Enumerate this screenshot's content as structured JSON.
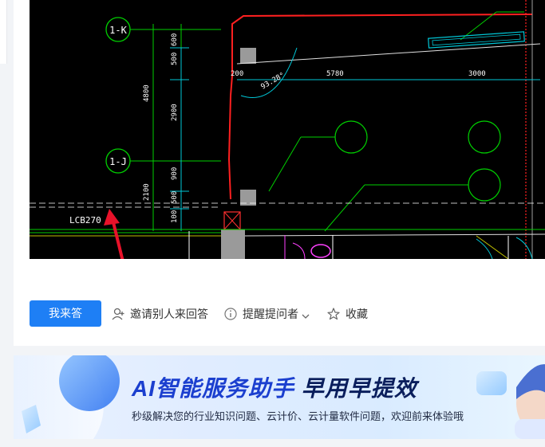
{
  "cad": {
    "grid_labels": [
      "1-K",
      "1-J"
    ],
    "dim_labels_top": [
      "200",
      "5780",
      "3000"
    ],
    "dim_labels_vertical": [
      "600",
      "500",
      "4800",
      "2900",
      "900",
      "500",
      "2100",
      "100"
    ],
    "angle_label": "93.28°",
    "beam_label": "LCB270"
  },
  "actions": {
    "answer_label": "我来答",
    "invite_label": "邀请别人来回答",
    "remind_label": "提醒提问者",
    "favorite_label": "收藏"
  },
  "banner": {
    "title_part1": "AI智能服务助手 ",
    "title_part2": "早用早提效",
    "subtitle": "秒级解决您的行业知识问题、云计价、云计量软件问题，欢迎前来体验哦"
  },
  "icons": {
    "invite": "user-plus-icon",
    "remind": "info-circle-icon",
    "remind_dropdown": "chevron-down-icon",
    "favorite": "star-icon",
    "banner_left": "glass-orb-icon",
    "banner_right": "robot-assistant-icon"
  },
  "colors": {
    "primary": "#1e7ff5",
    "banner_title": "#1b3fcf",
    "cad_bg": "#000000",
    "cad_red": "#ff2020",
    "cad_green": "#00d000",
    "cad_cyan": "#00c8d8"
  }
}
